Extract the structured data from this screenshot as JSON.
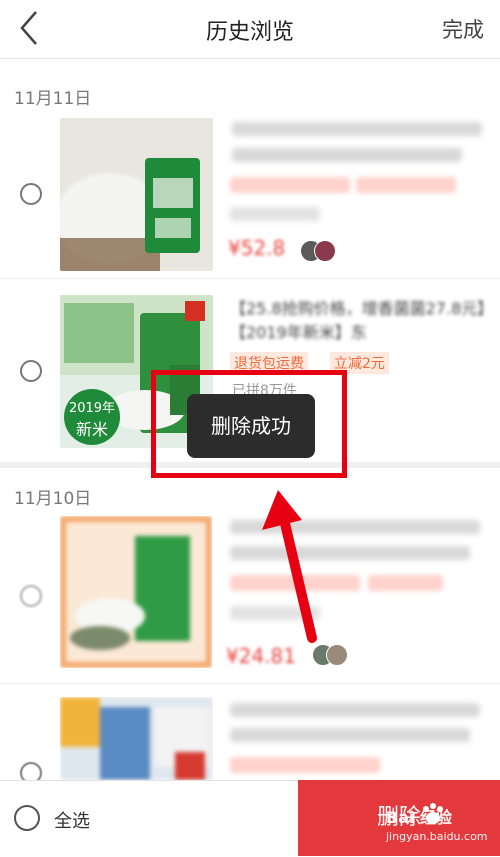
{
  "header": {
    "title": "历史浏览",
    "done_label": "完成",
    "back_icon": "chevron-left-icon"
  },
  "groups": [
    {
      "date": "11月11日"
    },
    {
      "date": "11月10日"
    }
  ],
  "items": [
    {
      "title": "【25.8抢购价格，增香菌菌27.8元】【2019年新米】东",
      "tag1": "退货包运费",
      "tag2": "立减2元",
      "sold": "已拼8万件",
      "badge_year": "2019年",
      "badge_text": "新米"
    }
  ],
  "toast": {
    "text": "删除成功"
  },
  "bottom_bar": {
    "select_all_label": "全选",
    "delete_label": "删除"
  },
  "watermark": {
    "text": "Bai 经验",
    "url": "jingyan.baidu.com"
  },
  "colors": {
    "accent_red": "#e4393c",
    "annotation_red": "#e60012",
    "tag_orange": "#f06a3b"
  }
}
